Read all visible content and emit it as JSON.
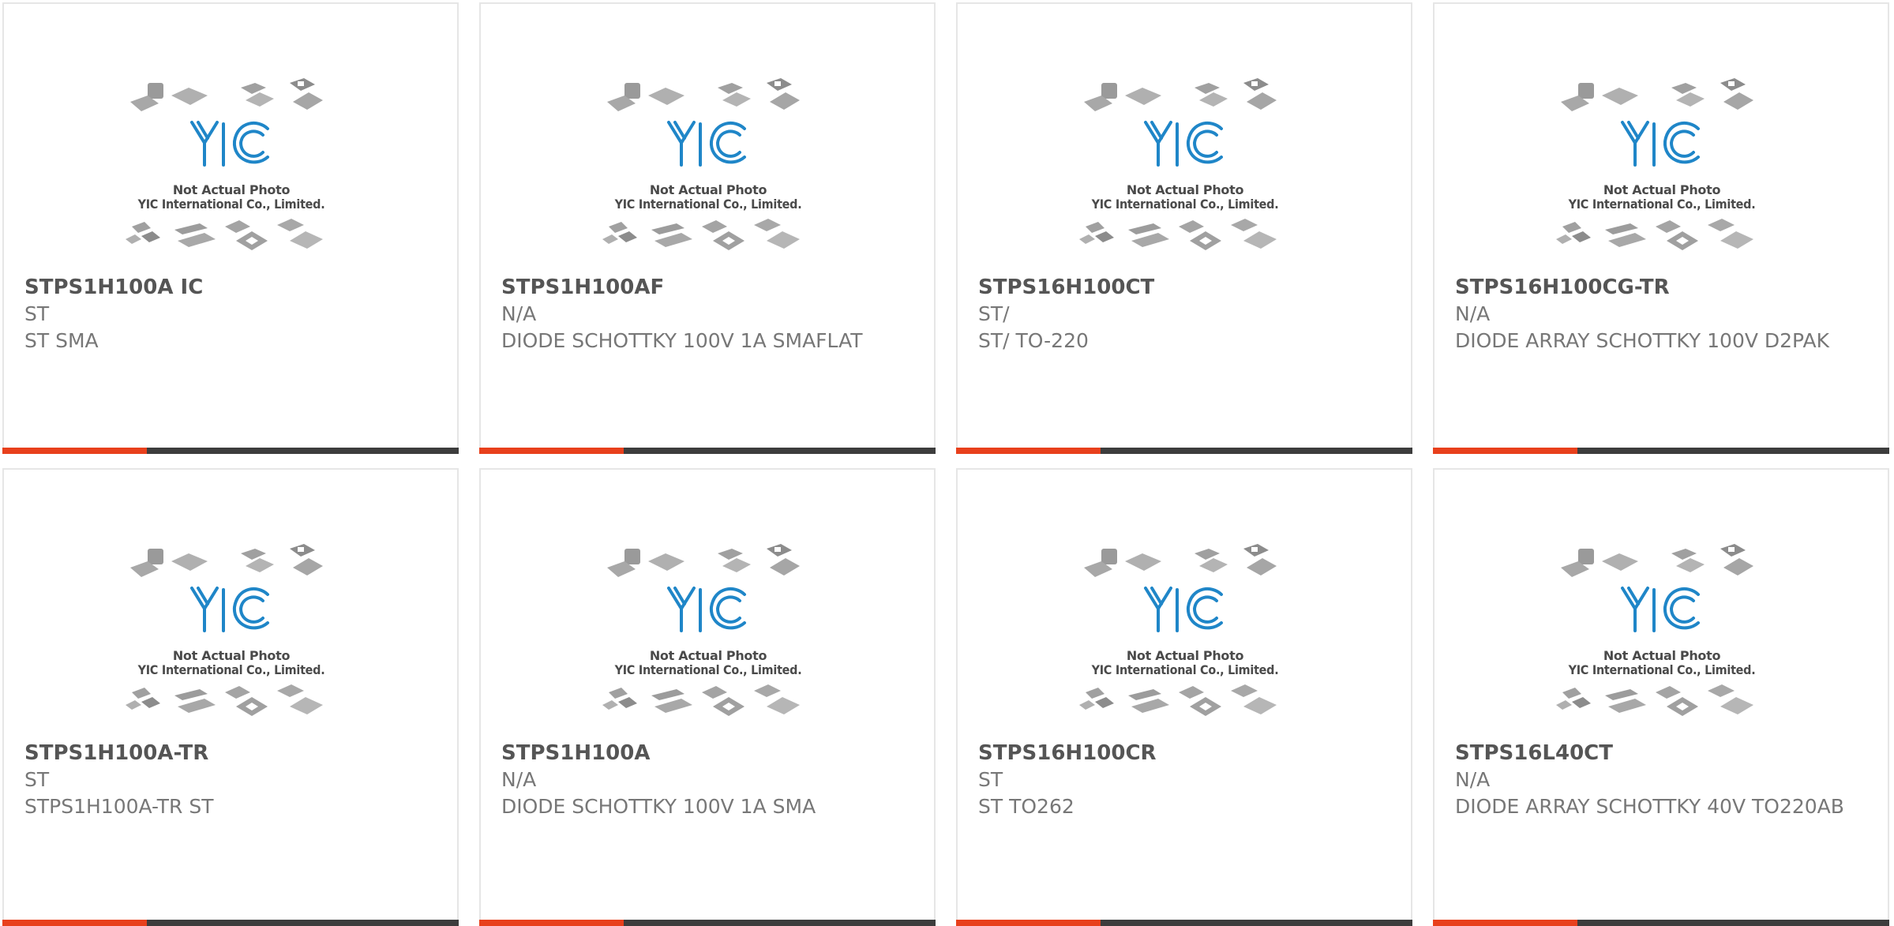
{
  "photo_caption": {
    "line1": "Not Actual Photo",
    "line2": "YIC International Co., Limited.",
    "logo_text": "YIC"
  },
  "colors": {
    "accent": "#e8401c",
    "bar": "#3d3d3d",
    "logo_blue": "#1f86c8"
  },
  "products": [
    {
      "part": "STPS1H100A IC",
      "manufacturer": "ST",
      "description": "ST SMA"
    },
    {
      "part": "STPS1H100AF",
      "manufacturer": "N/A",
      "description": "DIODE SCHOTTKY 100V 1A SMAFLAT"
    },
    {
      "part": "STPS16H100CT",
      "manufacturer": "ST/",
      "description": "ST/ TO-220"
    },
    {
      "part": "STPS16H100CG-TR",
      "manufacturer": "N/A",
      "description": "DIODE ARRAY SCHOTTKY 100V D2PAK"
    },
    {
      "part": "STPS1H100A-TR",
      "manufacturer": "ST",
      "description": "STPS1H100A-TR ST"
    },
    {
      "part": "STPS1H100A",
      "manufacturer": "N/A",
      "description": "DIODE SCHOTTKY 100V 1A SMA"
    },
    {
      "part": "STPS16H100CR",
      "manufacturer": "ST",
      "description": "ST TO262"
    },
    {
      "part": "STPS16L40CT",
      "manufacturer": "N/A",
      "description": "DIODE ARRAY SCHOTTKY 40V TO220AB"
    }
  ]
}
